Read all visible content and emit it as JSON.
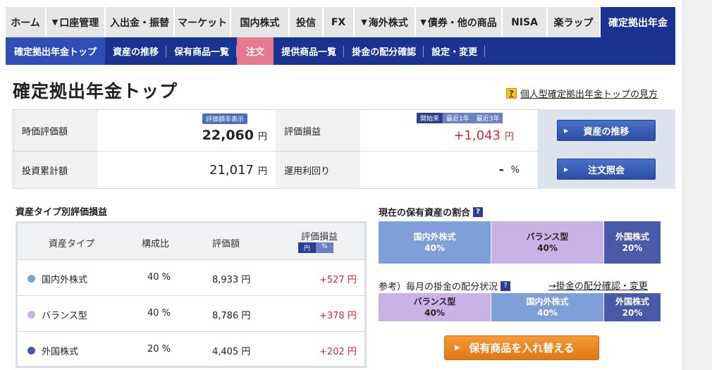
{
  "topnav": {
    "tabs": [
      {
        "label": "ホーム",
        "w": 58
      },
      {
        "label": "口座管理",
        "w": 84,
        "dropdown": true
      },
      {
        "label": "入出金・振替",
        "w": 98
      },
      {
        "label": "マーケット",
        "w": 80
      },
      {
        "label": "国内株式",
        "w": 83
      },
      {
        "label": "投信",
        "w": 48
      },
      {
        "label": "FX",
        "w": 44
      },
      {
        "label": "海外株式",
        "w": 87,
        "dropdown": true
      },
      {
        "label": "債券・他の商品",
        "w": 123,
        "dropdown": true
      },
      {
        "label": "NISA",
        "w": 64
      },
      {
        "label": "楽ラップ",
        "w": 75
      },
      {
        "label": "確定拠出年金",
        "w": 106,
        "active": true
      }
    ]
  },
  "subnav": {
    "items": [
      "確定拠出年金トップ",
      "資産の推移",
      "保有商品一覧",
      "注文",
      "提供商品一覧",
      "掛金の配分確認",
      "設定・変更"
    ]
  },
  "page_title": "確定拠出年金トップ",
  "help_link": "個人型確定拠出年金トップの見方",
  "summary": {
    "market_value_label": "時価評価額",
    "market_value": "22,060",
    "hide_badge": "評価額非表示",
    "yen": "円",
    "pl_label": "評価損益",
    "pl_value": "+1,043",
    "period_tabs": [
      "開始来",
      "最近1年",
      "最近3年"
    ],
    "invest_label": "投資累計額",
    "invest_value": "21,017",
    "yield_label": "運用利回り",
    "yield_value": "-",
    "yield_unit": "%",
    "btn_history": "資産の推移",
    "btn_orders": "注文照会"
  },
  "asset_table": {
    "title": "資産タイプ別評価損益",
    "headers": {
      "type": "資産タイプ",
      "ratio": "構成比",
      "value": "評価額",
      "pl": "評価損益"
    },
    "unit_tabs": [
      "円",
      "%"
    ],
    "rows": [
      {
        "name": "国内外株式",
        "ratio": "40 %",
        "value": "8,933 円",
        "pl": "+527 円",
        "color": "#7f9fd8"
      },
      {
        "name": "バランス型",
        "ratio": "40 %",
        "value": "8,786 円",
        "pl": "+378 円",
        "color": "#c9b3e6"
      },
      {
        "name": "外国株式",
        "ratio": "20 %",
        "value": "4,405 円",
        "pl": "+202 円",
        "color": "#4b5aa8"
      }
    ]
  },
  "holding_ratio": {
    "title": "現在の保有資産の割合",
    "segments": [
      {
        "label": "国内外株式",
        "pct": "40%",
        "share": 40,
        "bg": "#7f9fd8",
        "fg": "#ffffff"
      },
      {
        "label": "バランス型",
        "pct": "40%",
        "share": 40,
        "bg": "#c9b3e6",
        "fg": "#222222"
      },
      {
        "label": "外国株式",
        "pct": "20%",
        "share": 20,
        "bg": "#4b5aa8",
        "fg": "#ffffff"
      }
    ]
  },
  "contribution": {
    "title": "参考）毎月の掛金の配分状況",
    "link": "→掛金の配分確認・変更",
    "segments": [
      {
        "label": "バランス型",
        "pct": "40%",
        "share": 40,
        "bg": "#c9b3e6",
        "fg": "#222222"
      },
      {
        "label": "国内外株式",
        "pct": "40%",
        "share": 40,
        "bg": "#7f9fd8",
        "fg": "#ffffff"
      },
      {
        "label": "外国株式",
        "pct": "20%",
        "share": 20,
        "bg": "#4b5aa8",
        "fg": "#ffffff"
      }
    ]
  },
  "swap_button": "保有商品を入れ替える"
}
